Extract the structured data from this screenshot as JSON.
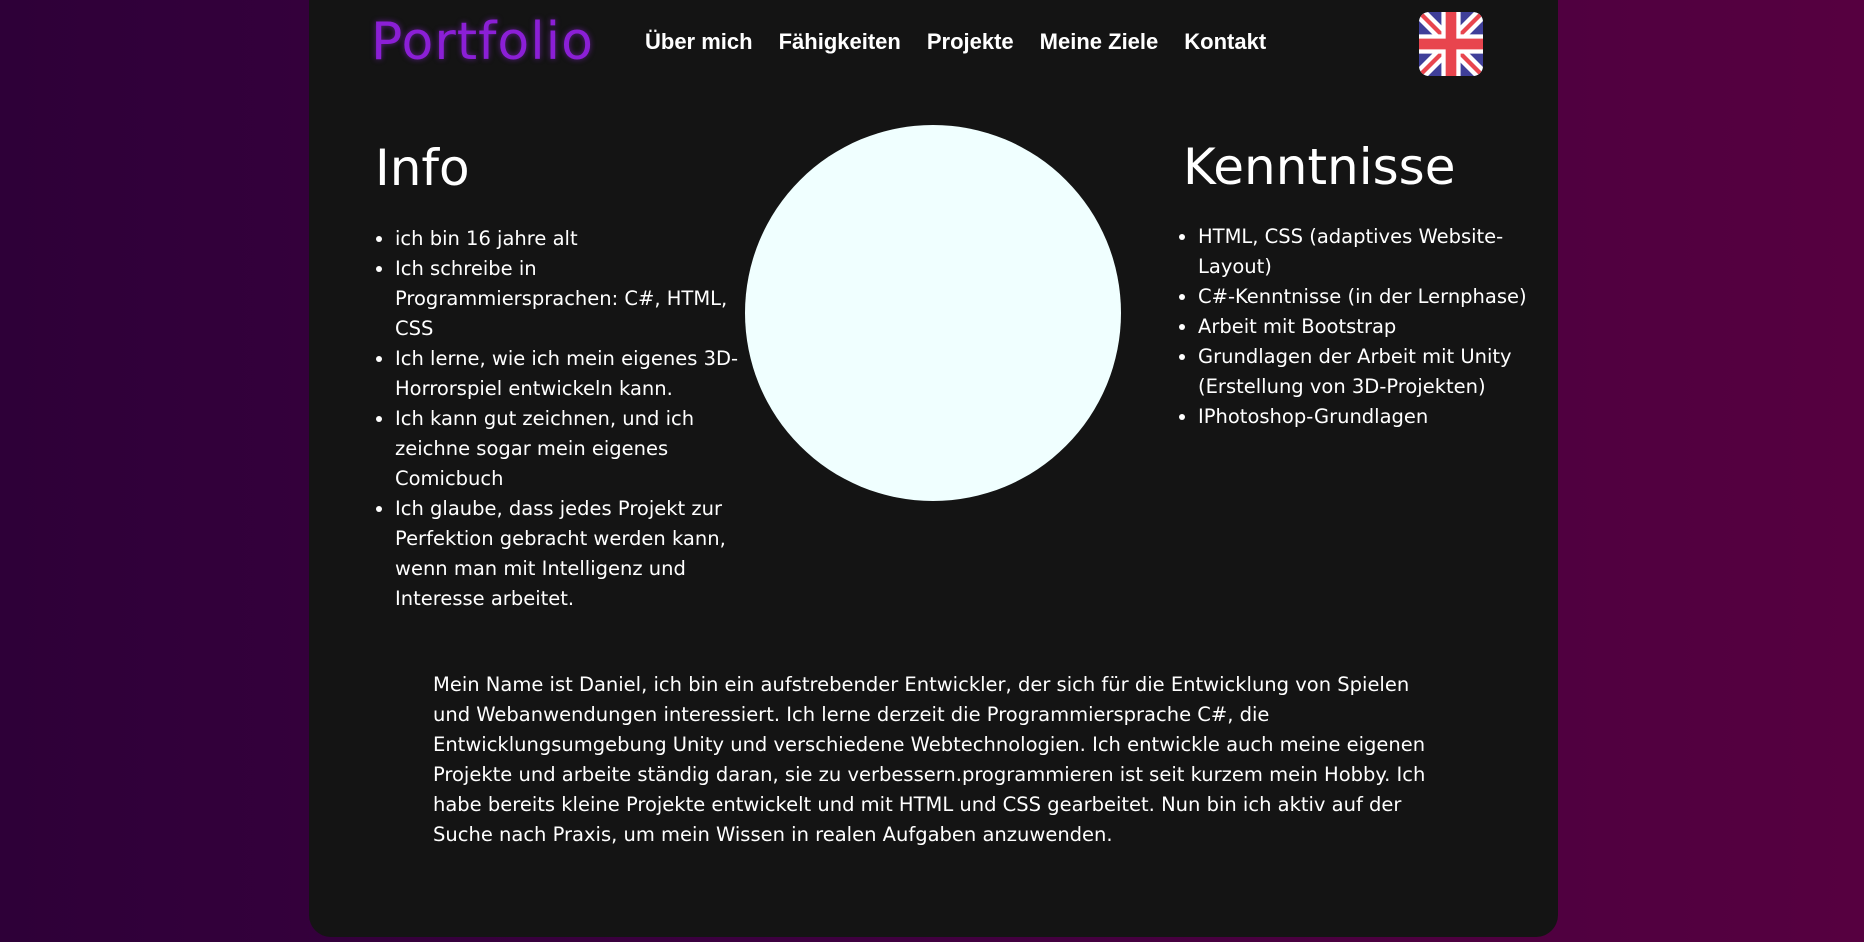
{
  "header": {
    "logo": "Portfolio",
    "nav": [
      "Über mich",
      "Fähigkeiten",
      "Projekte",
      "Meine Ziele",
      "Kontakt"
    ],
    "language_flag": "uk-flag-icon"
  },
  "info": {
    "title": "Info",
    "items": [
      "ich bin 16 jahre alt",
      "Ich schreibe in Programmiersprachen: C#, HTML, CSS",
      "Ich lerne, wie ich mein eigenes 3D-Horrorspiel entwickeln kann.",
      "Ich kann gut zeichnen, und ich zeichne sogar mein eigenes Comicbuch",
      "Ich glaube, dass jedes Projekt zur Perfektion gebracht werden kann, wenn man mit Intelligenz und Interesse arbeitet."
    ]
  },
  "skills": {
    "title": "Kenntnisse",
    "items": [
      "HTML, CSS (adaptives Website-Layout)",
      "C#-Kenntnisse (in der Lernphase)",
      "Arbeit mit Bootstrap",
      "Grundlagen der Arbeit mit Unity (Erstellung von 3D-Projekten)",
      "IPhotoshop-Grundlagen"
    ]
  },
  "about_text": "Mein Name ist Daniel, ich bin ein aufstrebender Entwickler, der sich für die Entwicklung von Spielen und Webanwendungen interessiert. Ich lerne derzeit die Programmiersprache C#, die Entwicklungsumgebung Unity und verschiedene Webtechnologien. Ich entwickle auch meine eigenen Projekte und arbeite ständig daran, sie zu verbessern.programmieren ist seit kurzem mein Hobby. Ich habe bereits kleine Projekte entwickelt und mit HTML und CSS gearbeitet. Nun bin ich aktiv auf der Suche nach Praxis, um mein Wissen in realen Aufgaben anzuwenden.",
  "colors": {
    "logo": "#8b1fd6",
    "panel": "#141414",
    "circle": "#f0ffff",
    "background_start": "#2e0038",
    "background_end": "#560040"
  }
}
